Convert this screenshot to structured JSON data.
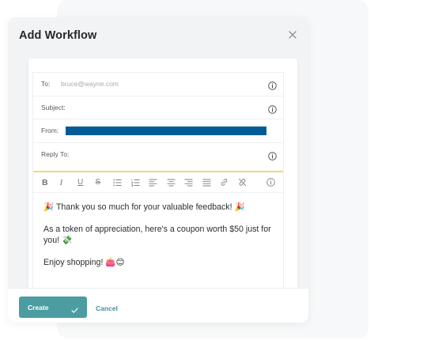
{
  "modal": {
    "title": "Add Workflow"
  },
  "email": {
    "to_label": "To:",
    "to_placeholder": "bruce@wayne.com",
    "subject_label": "Subject:",
    "from_label": "From:",
    "reply_to_label": "Reply To:"
  },
  "toolbar": {
    "bold": "B",
    "italic": "I",
    "underline": "U",
    "strike": "S"
  },
  "body": {
    "line1": "🎉 Thank you so much for your valuable feedback! 🎉",
    "line2": "As a token of appreciation, here's a coupon worth $50 just for you! 💸",
    "line3": "Enjoy shopping! 👛😊"
  },
  "footer": {
    "create_label": "Create",
    "cancel_label": "Cancel"
  },
  "colors": {
    "accent": "#4b9da2",
    "from_bar": "#005b96",
    "divider": "#f1d87a"
  }
}
